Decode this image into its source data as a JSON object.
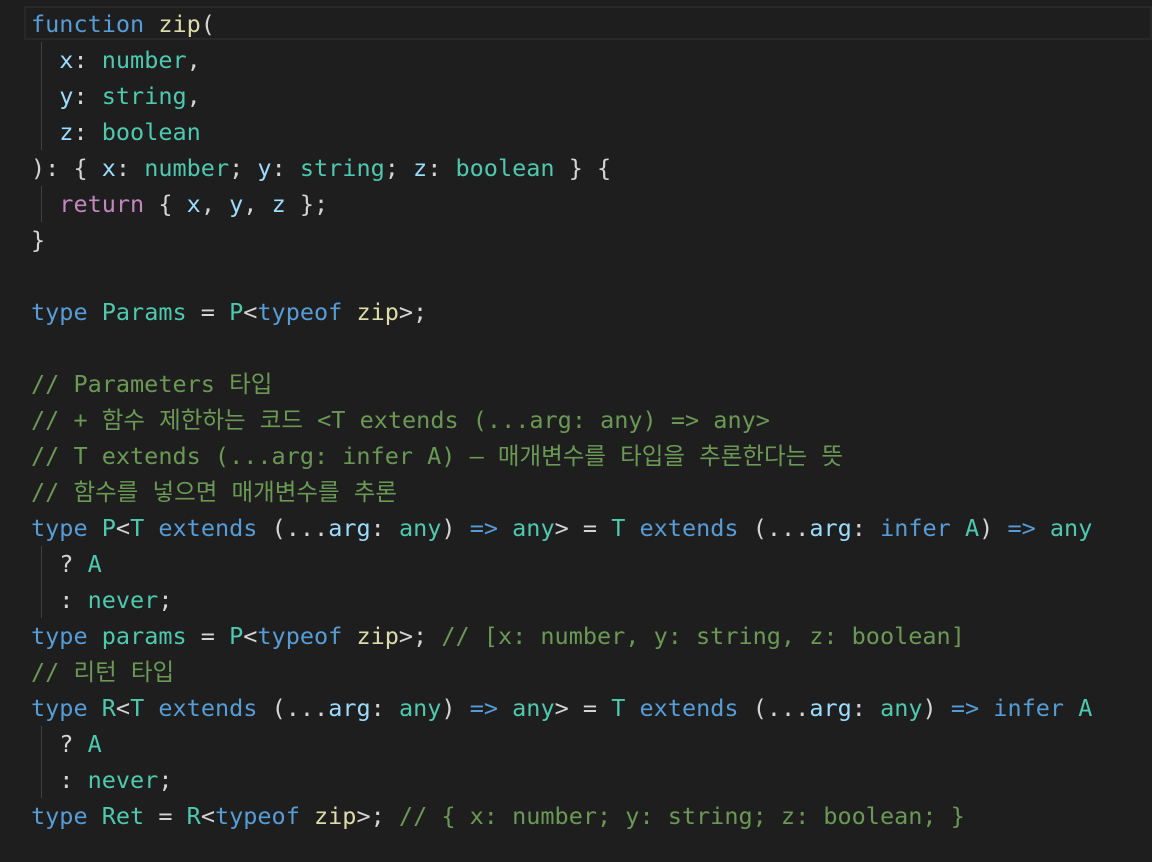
{
  "editor": {
    "colors": {
      "background": "#1e1e1e",
      "keyword": "#569cd6",
      "control": "#c586c0",
      "function": "#dcdcaa",
      "variable": "#9cdcfe",
      "type": "#4ec9b0",
      "punctuation": "#d4d4d4",
      "comment": "#6a9955"
    },
    "lines": [
      [
        [
          "kw",
          "function"
        ],
        [
          "op",
          " "
        ],
        [
          "fn",
          "zip"
        ],
        [
          "br",
          "("
        ]
      ],
      [
        [
          "op",
          "  "
        ],
        [
          "var",
          "x"
        ],
        [
          "op",
          ": "
        ],
        [
          "ty",
          "number"
        ],
        [
          "op",
          ","
        ]
      ],
      [
        [
          "op",
          "  "
        ],
        [
          "var",
          "y"
        ],
        [
          "op",
          ": "
        ],
        [
          "ty",
          "string"
        ],
        [
          "op",
          ","
        ]
      ],
      [
        [
          "op",
          "  "
        ],
        [
          "var",
          "z"
        ],
        [
          "op",
          ": "
        ],
        [
          "ty",
          "boolean"
        ]
      ],
      [
        [
          "br",
          ")"
        ],
        [
          "op",
          ": "
        ],
        [
          "br",
          "{"
        ],
        [
          "op",
          " "
        ],
        [
          "var",
          "x"
        ],
        [
          "op",
          ": "
        ],
        [
          "ty",
          "number"
        ],
        [
          "op",
          "; "
        ],
        [
          "var",
          "y"
        ],
        [
          "op",
          ": "
        ],
        [
          "ty",
          "string"
        ],
        [
          "op",
          "; "
        ],
        [
          "var",
          "z"
        ],
        [
          "op",
          ": "
        ],
        [
          "ty",
          "boolean"
        ],
        [
          "op",
          " "
        ],
        [
          "br",
          "}"
        ],
        [
          "op",
          " "
        ],
        [
          "br",
          "{"
        ]
      ],
      [
        [
          "op",
          "  "
        ],
        [
          "ctl",
          "return"
        ],
        [
          "op",
          " "
        ],
        [
          "br",
          "{"
        ],
        [
          "op",
          " "
        ],
        [
          "var",
          "x"
        ],
        [
          "op",
          ", "
        ],
        [
          "var",
          "y"
        ],
        [
          "op",
          ", "
        ],
        [
          "var",
          "z"
        ],
        [
          "op",
          " "
        ],
        [
          "br",
          "}"
        ],
        [
          "op",
          ";"
        ]
      ],
      [
        [
          "br",
          "}"
        ]
      ],
      [],
      [
        [
          "kw",
          "type"
        ],
        [
          "op",
          " "
        ],
        [
          "ty",
          "Params"
        ],
        [
          "op",
          " = "
        ],
        [
          "ty",
          "P"
        ],
        [
          "op",
          "<"
        ],
        [
          "kw",
          "typeof"
        ],
        [
          "op",
          " "
        ],
        [
          "fn",
          "zip"
        ],
        [
          "op",
          ">;"
        ]
      ],
      [],
      [
        [
          "cm",
          "// Parameters 타입"
        ]
      ],
      [
        [
          "cm",
          "// + 함수 제한하는 코드 <T extends (...arg: any) => any>"
        ]
      ],
      [
        [
          "cm",
          "// T extends (...arg: infer A) – 매개변수를 타입을 추론한다는 뜻"
        ]
      ],
      [
        [
          "cm",
          "// 함수를 넣으면 매개변수를 추론"
        ]
      ],
      [
        [
          "kw",
          "type"
        ],
        [
          "op",
          " "
        ],
        [
          "ty",
          "P"
        ],
        [
          "op",
          "<"
        ],
        [
          "ty",
          "T"
        ],
        [
          "op",
          " "
        ],
        [
          "kw",
          "extends"
        ],
        [
          "op",
          " "
        ],
        [
          "br",
          "("
        ],
        [
          "op",
          "..."
        ],
        [
          "var",
          "arg"
        ],
        [
          "op",
          ": "
        ],
        [
          "ty",
          "any"
        ],
        [
          "br",
          ")"
        ],
        [
          "op",
          " "
        ],
        [
          "kw",
          "=>"
        ],
        [
          "op",
          " "
        ],
        [
          "ty",
          "any"
        ],
        [
          "op",
          "> = "
        ],
        [
          "ty",
          "T"
        ],
        [
          "op",
          " "
        ],
        [
          "kw",
          "extends"
        ],
        [
          "op",
          " "
        ],
        [
          "br",
          "("
        ],
        [
          "op",
          "..."
        ],
        [
          "var",
          "arg"
        ],
        [
          "op",
          ": "
        ],
        [
          "kw",
          "infer"
        ],
        [
          "op",
          " "
        ],
        [
          "ty",
          "A"
        ],
        [
          "br",
          ")"
        ],
        [
          "op",
          " "
        ],
        [
          "kw",
          "=>"
        ],
        [
          "op",
          " "
        ],
        [
          "ty",
          "any"
        ]
      ],
      [
        [
          "op",
          "  ? "
        ],
        [
          "ty",
          "A"
        ]
      ],
      [
        [
          "op",
          "  : "
        ],
        [
          "ty",
          "never"
        ],
        [
          "op",
          ";"
        ]
      ],
      [
        [
          "kw",
          "type"
        ],
        [
          "op",
          " "
        ],
        [
          "ty",
          "params"
        ],
        [
          "op",
          " = "
        ],
        [
          "ty",
          "P"
        ],
        [
          "op",
          "<"
        ],
        [
          "kw",
          "typeof"
        ],
        [
          "op",
          " "
        ],
        [
          "fn",
          "zip"
        ],
        [
          "op",
          ">; "
        ],
        [
          "cm",
          "// [x: number, y: string, z: boolean]"
        ]
      ],
      [
        [
          "cm",
          "// 리턴 타입"
        ]
      ],
      [
        [
          "kw",
          "type"
        ],
        [
          "op",
          " "
        ],
        [
          "ty",
          "R"
        ],
        [
          "op",
          "<"
        ],
        [
          "ty",
          "T"
        ],
        [
          "op",
          " "
        ],
        [
          "kw",
          "extends"
        ],
        [
          "op",
          " "
        ],
        [
          "br",
          "("
        ],
        [
          "op",
          "..."
        ],
        [
          "var",
          "arg"
        ],
        [
          "op",
          ": "
        ],
        [
          "ty",
          "any"
        ],
        [
          "br",
          ")"
        ],
        [
          "op",
          " "
        ],
        [
          "kw",
          "=>"
        ],
        [
          "op",
          " "
        ],
        [
          "ty",
          "any"
        ],
        [
          "op",
          "> = "
        ],
        [
          "ty",
          "T"
        ],
        [
          "op",
          " "
        ],
        [
          "kw",
          "extends"
        ],
        [
          "op",
          " "
        ],
        [
          "br",
          "("
        ],
        [
          "op",
          "..."
        ],
        [
          "var",
          "arg"
        ],
        [
          "op",
          ": "
        ],
        [
          "ty",
          "any"
        ],
        [
          "br",
          ")"
        ],
        [
          "op",
          " "
        ],
        [
          "kw",
          "=>"
        ],
        [
          "op",
          " "
        ],
        [
          "kw",
          "infer"
        ],
        [
          "op",
          " "
        ],
        [
          "ty",
          "A"
        ]
      ],
      [
        [
          "op",
          "  ? "
        ],
        [
          "ty",
          "A"
        ]
      ],
      [
        [
          "op",
          "  : "
        ],
        [
          "ty",
          "never"
        ],
        [
          "op",
          ";"
        ]
      ],
      [
        [
          "kw",
          "type"
        ],
        [
          "op",
          " "
        ],
        [
          "ty",
          "Ret"
        ],
        [
          "op",
          " = "
        ],
        [
          "ty",
          "R"
        ],
        [
          "op",
          "<"
        ],
        [
          "kw",
          "typeof"
        ],
        [
          "op",
          " "
        ],
        [
          "fn",
          "zip"
        ],
        [
          "op",
          ">; "
        ],
        [
          "cm",
          "// { x: number; y: string; z: boolean; }"
        ]
      ]
    ]
  }
}
